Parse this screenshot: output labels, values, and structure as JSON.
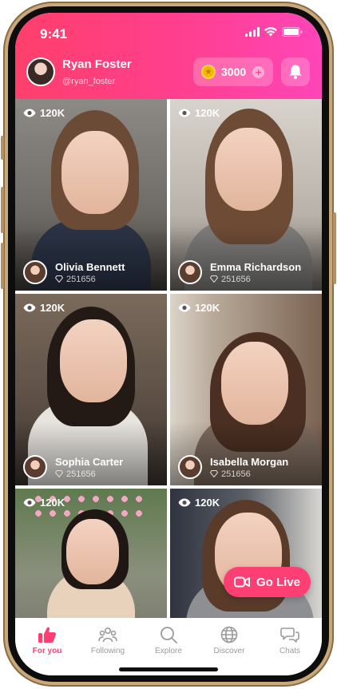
{
  "status_bar": {
    "time": "9:41"
  },
  "profile": {
    "name": "Ryan Foster",
    "handle": "@ryan_foster"
  },
  "wallet": {
    "coins": "3000"
  },
  "streams": [
    {
      "viewers": "120K",
      "host": "Olivia Bennett",
      "score": "251656"
    },
    {
      "viewers": "120K",
      "host": "Emma Richardson",
      "score": "251656"
    },
    {
      "viewers": "120K",
      "host": "Sophia Carter",
      "score": "251656"
    },
    {
      "viewers": "120K",
      "host": "Isabella Morgan",
      "score": "251656"
    },
    {
      "viewers": "120K"
    },
    {
      "viewers": "120K"
    }
  ],
  "go_live": {
    "label": "Go Live"
  },
  "tabs": [
    {
      "label": "For you",
      "icon": "thumbs-up-icon",
      "active": true
    },
    {
      "label": "Following",
      "icon": "people-icon"
    },
    {
      "label": "Explore",
      "icon": "search-icon"
    },
    {
      "label": "Discover",
      "icon": "globe-icon"
    },
    {
      "label": "Chats",
      "icon": "chat-icon"
    }
  ],
  "colors": {
    "accent": "#ff3f74",
    "header_start": "#ff3f6b",
    "header_end": "#ff45b8",
    "coin": "#f6b800"
  }
}
